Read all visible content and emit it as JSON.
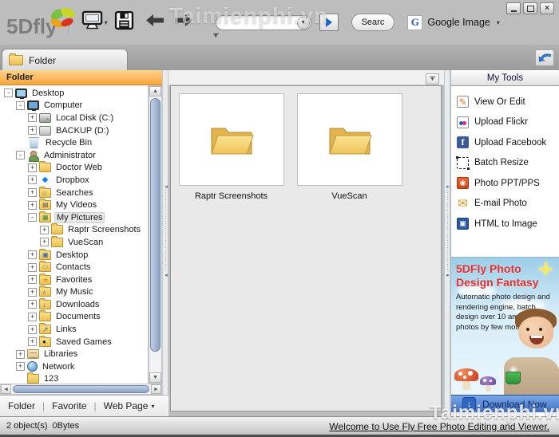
{
  "window": {
    "buttons": [
      {
        "name": "minimize"
      },
      {
        "name": "maximize"
      },
      {
        "name": "close"
      }
    ]
  },
  "toolbar": {
    "logo_text": "5Dfly",
    "search_value": "",
    "search_button": "Searc",
    "google_label": "Google Image"
  },
  "tab_bar": {
    "active_tab": "Folder"
  },
  "left_panel": {
    "header": "Folder",
    "tree": [
      {
        "label": "Desktop",
        "level": 0,
        "exp": "-",
        "icon": "desktop"
      },
      {
        "label": "Computer",
        "level": 1,
        "exp": "-",
        "icon": "computer"
      },
      {
        "label": "Local Disk (C:)",
        "level": 2,
        "exp": "+",
        "icon": "disk"
      },
      {
        "label": "BACKUP (D:)",
        "level": 2,
        "exp": "+",
        "icon": "drive"
      },
      {
        "label": "Recycle Bin",
        "level": 1,
        "exp": "",
        "icon": "recycle"
      },
      {
        "label": "Administrator",
        "level": 1,
        "exp": "-",
        "icon": "user"
      },
      {
        "label": "Doctor Web",
        "level": 2,
        "exp": "+",
        "icon": "folder"
      },
      {
        "label": "Dropbox",
        "level": 2,
        "exp": "+",
        "icon": "dropbox"
      },
      {
        "label": "Searches",
        "level": 2,
        "exp": "+",
        "icon": "search-folder"
      },
      {
        "label": "My Videos",
        "level": 2,
        "exp": "+",
        "icon": "videos"
      },
      {
        "label": "My Pictures",
        "level": 2,
        "exp": "-",
        "icon": "pictures",
        "selected": true
      },
      {
        "label": "Raptr Screenshots",
        "level": 3,
        "exp": "+",
        "icon": "folder"
      },
      {
        "label": "VueScan",
        "level": 3,
        "exp": "+",
        "icon": "folder"
      },
      {
        "label": "Desktop",
        "level": 2,
        "exp": "+",
        "icon": "desktop-folder"
      },
      {
        "label": "Contacts",
        "level": 2,
        "exp": "+",
        "icon": "contacts"
      },
      {
        "label": "Favorites",
        "level": 2,
        "exp": "+",
        "icon": "favorites"
      },
      {
        "label": "My Music",
        "level": 2,
        "exp": "+",
        "icon": "music"
      },
      {
        "label": "Downloads",
        "level": 2,
        "exp": "+",
        "icon": "downloads"
      },
      {
        "label": "Documents",
        "level": 2,
        "exp": "+",
        "icon": "folder"
      },
      {
        "label": "Links",
        "level": 2,
        "exp": "+",
        "icon": "links"
      },
      {
        "label": "Saved Games",
        "level": 2,
        "exp": "+",
        "icon": "games"
      },
      {
        "label": "Libraries",
        "level": 1,
        "exp": "+",
        "icon": "libraries"
      },
      {
        "label": "Network",
        "level": 1,
        "exp": "+",
        "icon": "network"
      },
      {
        "label": "123",
        "level": 1,
        "exp": "",
        "icon": "folder"
      }
    ],
    "bottom_tabs": [
      {
        "label": "Folder",
        "dropdown": false
      },
      {
        "label": "Favorite",
        "dropdown": false
      },
      {
        "label": "Web Page",
        "dropdown": true
      }
    ]
  },
  "content": {
    "items": [
      {
        "label": "Raptr Screenshots"
      },
      {
        "label": "VueScan"
      }
    ]
  },
  "tools": {
    "header": "My Tools",
    "items": [
      {
        "label": "View Or Edit",
        "icon": "view-edit"
      },
      {
        "label": "Upload Flickr",
        "icon": "flickr"
      },
      {
        "label": "Upload Facebook",
        "icon": "facebook"
      },
      {
        "label": "Batch Resize",
        "icon": "batch-resize"
      },
      {
        "label": "Photo PPT/PPS",
        "icon": "ppt"
      },
      {
        "label": "E-mail Photo",
        "icon": "email"
      },
      {
        "label": "HTML to Image",
        "icon": "html-image"
      }
    ]
  },
  "ad": {
    "title_line1": "5DFly Photo",
    "title_line2": "Design Fantasy",
    "body": "Automatic photo design and rendering engine, batch design over 10 amazing photos by few mouse clicks.",
    "download_label": "Download Now"
  },
  "status": {
    "objects": "2 object(s)",
    "size": "0Bytes",
    "link": "Welcome to Use Fly Free Photo Editing and Viewer."
  },
  "watermark": "Taimienphi.vn",
  "colors": {
    "accent_orange": "#f7a53c",
    "ad_title_red": "#e2312e",
    "download_blue": "#3f6fc4",
    "scroll_thumb_blue": "#8ba3c4",
    "facebook_blue": "#3b5998"
  }
}
